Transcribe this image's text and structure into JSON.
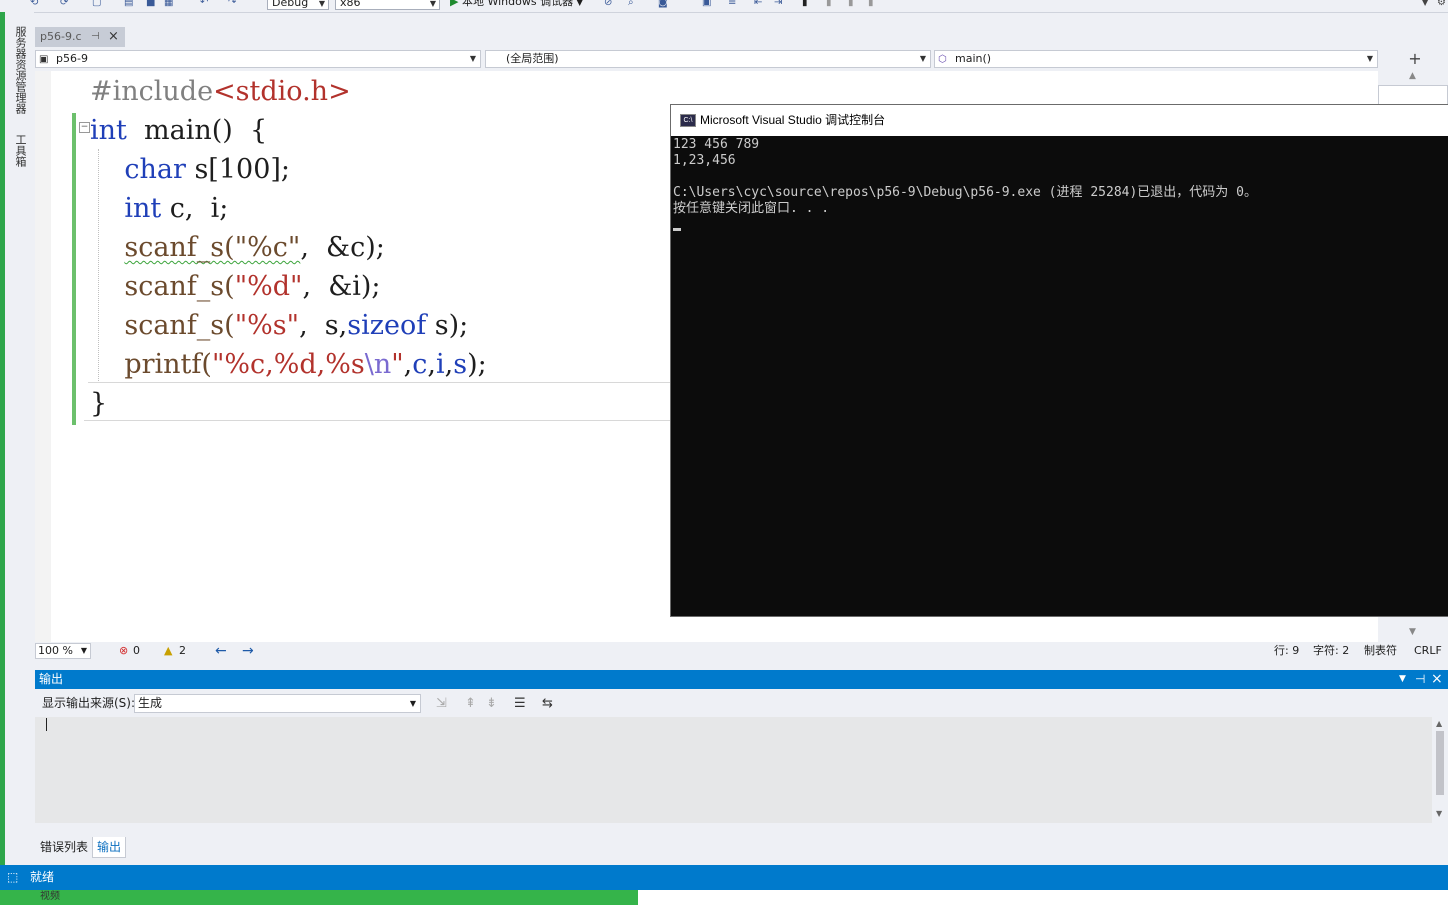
{
  "toolbar": {
    "config": "Debug",
    "platform": "x86",
    "run_label": "本地 Windows 调试器"
  },
  "left_strip": {
    "tabs": [
      "服务器资源管理器",
      "工具箱"
    ]
  },
  "doc_tab": {
    "name": "p56-9.c",
    "pin": "⊣",
    "close": "×"
  },
  "navbar": {
    "project": "p56-9",
    "scope": "(全局范围)",
    "member": "main()"
  },
  "editor": {
    "lines": [
      {
        "tokens": [
          [
            "pp",
            "#include"
          ],
          [
            "str",
            "<stdio.h>"
          ]
        ]
      },
      {
        "tokens": [
          [
            "kw",
            "int"
          ],
          [
            "",
            "  main()  {"
          ]
        ]
      },
      {
        "tokens": [
          [
            "",
            "    "
          ],
          [
            "kw",
            "char"
          ],
          [
            "",
            " s[100];"
          ]
        ]
      },
      {
        "tokens": [
          [
            "",
            "    "
          ],
          [
            "kw",
            "int"
          ],
          [
            "",
            " c,  i;"
          ]
        ]
      },
      {
        "tokens": [
          [
            "",
            "    "
          ],
          [
            "fnsq",
            "scanf_s(\"%c\""
          ],
          [
            "",
            ",  &c);"
          ]
        ]
      },
      {
        "tokens": [
          [
            "",
            "    "
          ],
          [
            "fn",
            "scanf_s("
          ],
          [
            "str",
            "\"%d\""
          ],
          [
            "",
            ",  &i);"
          ]
        ]
      },
      {
        "tokens": [
          [
            "",
            "    "
          ],
          [
            "fn",
            "scanf_s("
          ],
          [
            "str",
            "\"%s\""
          ],
          [
            "",
            ",  s,"
          ],
          [
            "kw",
            "sizeof"
          ],
          [
            "",
            " s);"
          ]
        ]
      },
      {
        "tokens": [
          [
            "",
            "    "
          ],
          [
            "fn",
            "printf("
          ],
          [
            "str",
            "\"%c,%d,%s"
          ],
          [
            "esc",
            "\\n"
          ],
          [
            "str",
            "\""
          ],
          [
            "",
            ","
          ],
          [
            "var",
            "c"
          ],
          [
            "",
            ","
          ],
          [
            "var",
            "i"
          ],
          [
            "",
            ","
          ],
          [
            "var",
            "s"
          ],
          [
            "",
            ");"
          ]
        ]
      },
      {
        "tokens": [
          [
            "",
            "}"
          ]
        ]
      }
    ]
  },
  "console": {
    "title": "Microsoft Visual Studio 调试控制台",
    "icon_text": "C:\\",
    "lines": [
      "123 456 789",
      "1,23,456",
      "",
      "C:\\Users\\cyc\\source\\repos\\p56-9\\Debug\\p56-9.exe (进程 25284)已退出，代码为 0。",
      "按任意键关闭此窗口. . ."
    ]
  },
  "editor_status": {
    "zoom": "100 %",
    "errors": "0",
    "warnings": "2",
    "line": "行: 9",
    "char": "字符: 2",
    "tabs": "制表符",
    "eol": "CRLF"
  },
  "output": {
    "title": "输出",
    "source_label": "显示输出来源(S):",
    "source_value": "生成"
  },
  "bottom_tabs": [
    "错误列表",
    "输出"
  ],
  "statusbar": {
    "text": "就绪"
  },
  "taskbar": {
    "label": "视频"
  },
  "colors": {
    "accent": "#007acc",
    "keyword": "#1f3fb8",
    "string": "#b2322c",
    "console_bg": "#0c0c0c"
  }
}
